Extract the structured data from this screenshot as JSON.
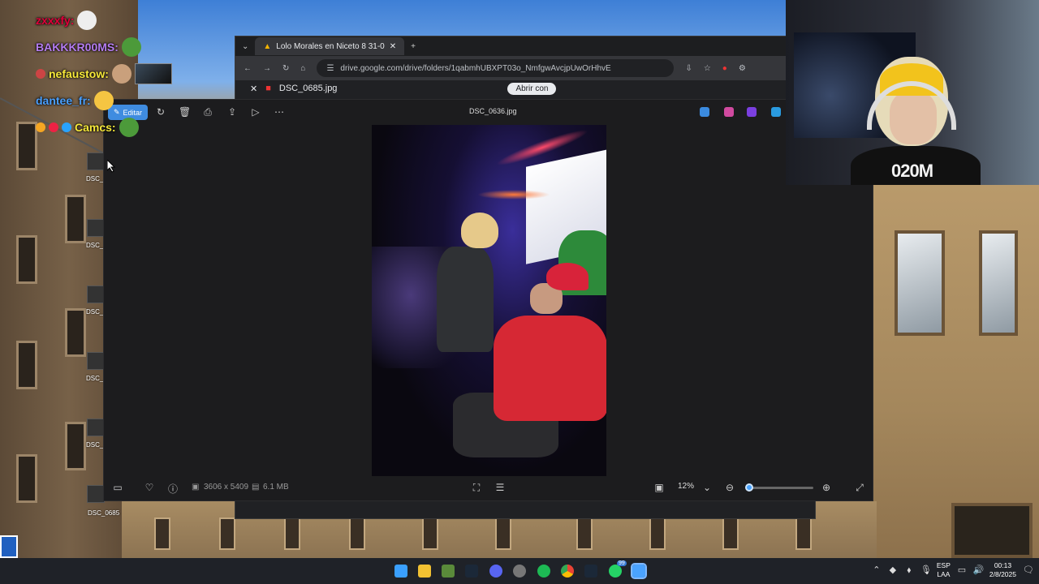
{
  "chat": {
    "lines": [
      {
        "user": "zxxxfy:",
        "color": "#e0003a"
      },
      {
        "user": "BAKKKR00MS:",
        "color": "#b47cf0"
      },
      {
        "user": "nefaustow:",
        "color": "#f7e93a"
      },
      {
        "user": "dantee_fr:",
        "color": "#4aa0ff"
      },
      {
        "user": "Camcs:",
        "color": "#f7e93a"
      }
    ]
  },
  "desktop": {
    "icon_labels": [
      "DSC_",
      "DSC_",
      "DSC_",
      "DSC_",
      "DSC_",
      "DSC_0685"
    ]
  },
  "browser": {
    "tab_title": "Lolo Morales en Niceto 8 31-0",
    "url": "drive.google.com/drive/folders/1qabmhUBXPT03o_NmfgwAvcjpUwOrHhvE",
    "file_title": "DSC_0685.jpg",
    "open_with": "Abrir con"
  },
  "viewer": {
    "edit_label": "Editar",
    "filename": "DSC_0636.jpg",
    "dimensions": "3606 x 5409",
    "size": "6.1 MB",
    "zoom": "12%",
    "zoom_fraction": 0.0
  },
  "webcam": {
    "shirt_text": "020M"
  },
  "taskbar": {
    "lang_line1": "ESP",
    "lang_line2": "LAA",
    "time": "00:13",
    "date": "2/8/2025",
    "whatsapp_badge": "99"
  }
}
